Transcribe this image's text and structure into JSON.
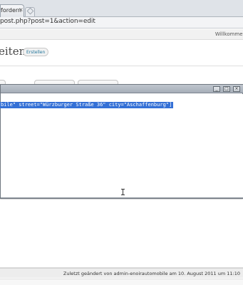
{
  "browser": {
    "tab_title": "fordern",
    "tab_close": "×",
    "address": "post.php?post=1&action=edit"
  },
  "admin": {
    "welcome": "Willkommen"
  },
  "page": {
    "title": "eiten",
    "create_button": "Erstellen"
  },
  "dialog": {
    "minimize": "_",
    "maximize": "□",
    "close": "×",
    "code_text": "bile\" street=\"Würzburger Straße 36\" city=\"Aschaffenburg\"]"
  },
  "footer": {
    "last_modified": "Zuletzt geändert von admin-enoirautomobile am 10. August 2011 um 11:10"
  }
}
